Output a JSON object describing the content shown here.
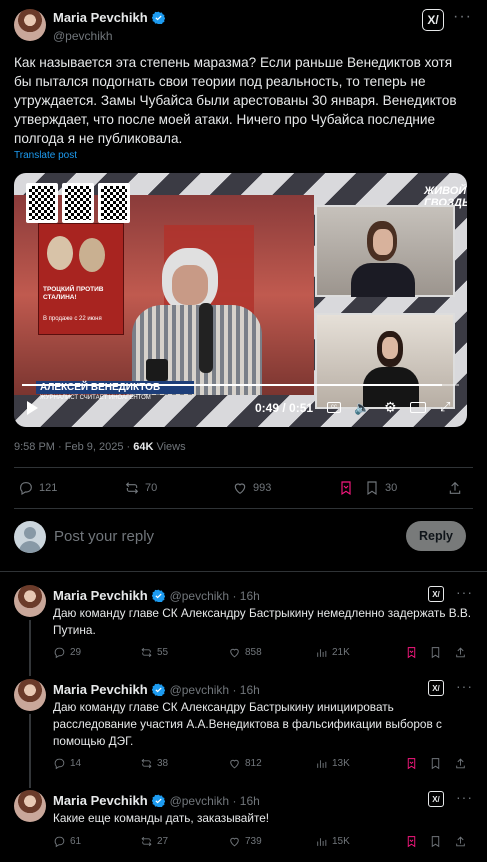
{
  "main_post": {
    "author_name": "Maria Pevchikh",
    "author_handle": "@pevchikh",
    "text": "Как называется эта степень маразма? Если раньше Венедиктов хотя бы пытался подогнать свои теории под реальность, то теперь не утруждается. Замы Чубайса были арестованы 30 января. Венедиктов утверждает, что после моей атаки. Ничего про Чубайса последние полгода я не публиковала.",
    "translate_label": "Translate post",
    "timestamp": "9:58 PM · Feb 9, 2025 · ",
    "views_count": "64K",
    "views_label": " Views",
    "replies": "121",
    "reposts": "70",
    "likes": "993",
    "bookmarks": "30"
  },
  "video": {
    "overlay_logo": "ЖИВОЙ ГВОЗДЬ",
    "lower_third_name": "АЛЕКСЕЙ ВЕНЕДИКТОВ",
    "lower_third_sub": "ЖУРНАЛИСТ СЧИТАЕТ ИНОАГЕНТОМ",
    "poster_text": "ТРОЦКИЙ ПРОТИВ СТАЛИНА!",
    "poster_text2": "В продаже с 22 июня",
    "time": "0:49 / 0:51",
    "progress": 0.96
  },
  "composer": {
    "placeholder": "Post your reply",
    "reply_button": "Reply"
  },
  "replies": [
    {
      "author_name": "Maria Pevchikh",
      "author_handle": "@pevchikh · 16h",
      "text": "Даю команду главе СК Александру Бастрыкину немедленно задержать В.В. Путина.",
      "replies": "29",
      "reposts": "55",
      "likes": "858",
      "views": "21K"
    },
    {
      "author_name": "Maria Pevchikh",
      "author_handle": "@pevchikh · 16h",
      "text": "Даю команду главе СК Александру Бастрыкину инициировать расследование участия А.А.Венедиктова в фальсификации выборов с помощью ДЭГ.",
      "replies": "14",
      "reposts": "38",
      "likes": "812",
      "views": "13K"
    },
    {
      "author_name": "Maria Pevchikh",
      "author_handle": "@pevchikh · 16h",
      "text": "Какие еще команды дать, заказывайте!",
      "replies": "61",
      "reposts": "27",
      "likes": "739",
      "views": "15K"
    }
  ],
  "icons": {
    "verified": "verified-badge-icon",
    "grok": "grok-icon",
    "more": "more-dots-icon",
    "reply": "reply-icon",
    "repost": "repost-icon",
    "like": "like-icon",
    "views": "views-icon",
    "bookmark": "bookmark-icon",
    "share": "share-icon"
  },
  "colors": {
    "background": "#000000",
    "text": "#e7e9ea",
    "muted": "#71767b",
    "accent": "#1d9bf0",
    "bookmark_accent": "#f91880",
    "divider": "#2f3336"
  }
}
